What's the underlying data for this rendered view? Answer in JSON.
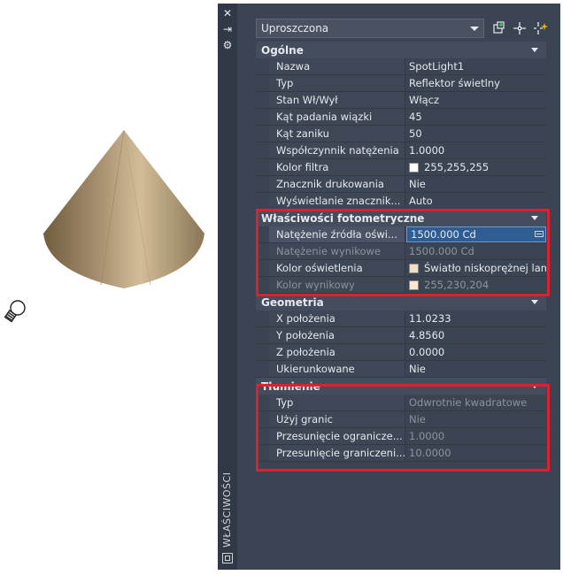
{
  "palette": {
    "side_title": "WŁAŚCIWOŚCI",
    "selector": {
      "value": "Uproszczona"
    },
    "sections": [
      {
        "title": "Ogólne",
        "rows": [
          {
            "name": "Nazwa",
            "value": "SpotLight1"
          },
          {
            "name": "Typ",
            "value": "Reflektor świetlny"
          },
          {
            "name": "Stan Wł/Wył",
            "value": "Włącz"
          },
          {
            "name": "Kąt padania wiązki",
            "value": "45"
          },
          {
            "name": "Kąt zaniku",
            "value": "50"
          },
          {
            "name": "Współczynnik natężenia",
            "value": "1.0000"
          },
          {
            "name": "Kolor filtra",
            "value": "255,255,255",
            "swatch": "#ffffff"
          },
          {
            "name": "Znacznik drukowania",
            "value": "Nie"
          },
          {
            "name": "Wyświetlanie  znacznik...",
            "value": "Auto"
          }
        ]
      },
      {
        "title": "Właściwości fotometryczne",
        "rows": [
          {
            "name": "Natężenie  źródła  oświ...",
            "value": "1500.000 Cd",
            "selected": true
          },
          {
            "name": "Natężenie wynikowe",
            "value": "1500.000 Cd",
            "dim": true
          },
          {
            "name": "Kolor oświetlenia",
            "value": "Światło niskoprężnej  lam...",
            "swatch": "#f3dcc3"
          },
          {
            "name": "Kolor wynikowy",
            "value": "255,230,204",
            "swatch": "#ffe6cc",
            "dim": true
          }
        ]
      },
      {
        "title": "Geometria",
        "rows": [
          {
            "name": "X położenia",
            "value": "11.0233"
          },
          {
            "name": "Y położenia",
            "value": "4.8560"
          },
          {
            "name": "Z położenia",
            "value": "0.0000"
          },
          {
            "name": "Ukierunkowane",
            "value": "Nie"
          }
        ]
      },
      {
        "title": "Tłumienie",
        "rows": [
          {
            "name": "Typ",
            "value": "Odwrotnie kwadratowe",
            "dim": true
          },
          {
            "name": "Użyj granic",
            "value": "Nie",
            "dim": true
          },
          {
            "name": "Przesunięcie  ogranicze...",
            "value": "1.0000",
            "dim": true
          },
          {
            "name": "Przesunięcie  graniczeni...",
            "value": "10.0000",
            "dim": true
          }
        ]
      }
    ]
  },
  "colors": {
    "panel_bg": "#3b4453",
    "highlight": "#e0202e",
    "selection": "#2f5d91"
  }
}
